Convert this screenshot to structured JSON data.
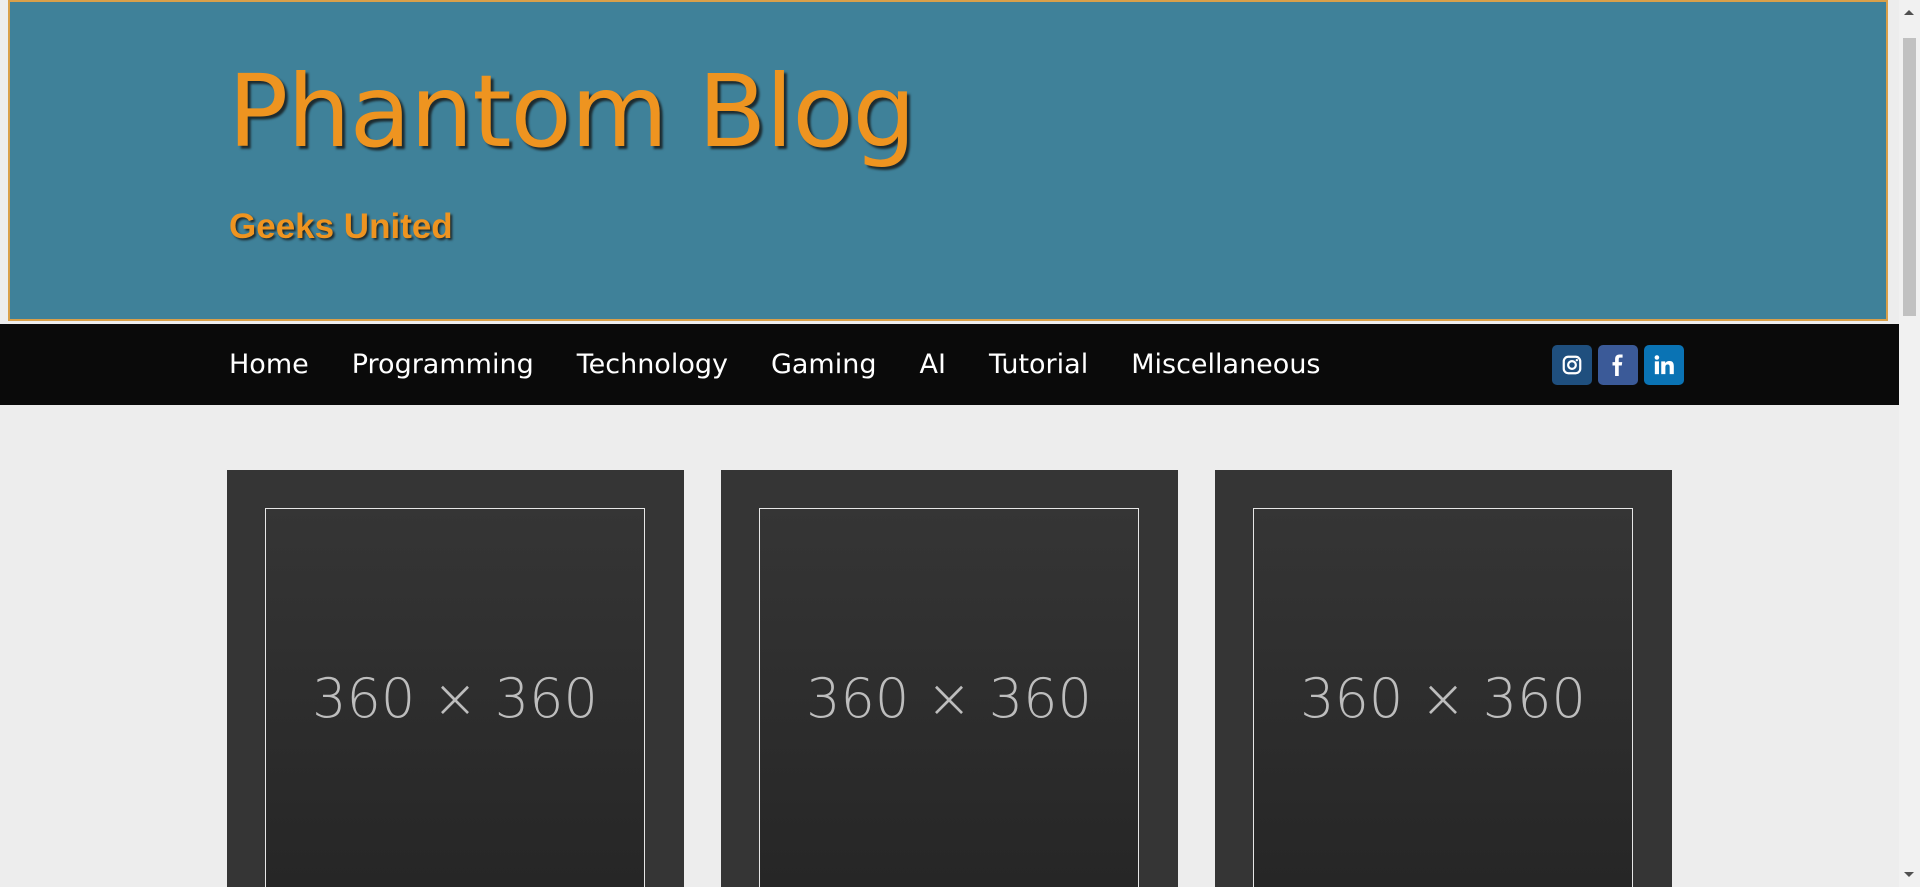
{
  "header": {
    "title": "Phantom Blog",
    "tagline": "Geeks United"
  },
  "nav": {
    "items": [
      {
        "label": "Home"
      },
      {
        "label": "Programming"
      },
      {
        "label": "Technology"
      },
      {
        "label": "Gaming"
      },
      {
        "label": "AI"
      },
      {
        "label": "Tutorial"
      },
      {
        "label": "Miscellaneous"
      }
    ]
  },
  "social": {
    "items": [
      {
        "icon": "instagram-icon",
        "color": "#1f4f7e"
      },
      {
        "icon": "facebook-icon",
        "color": "#3b5a98"
      },
      {
        "icon": "linkedin-icon",
        "color": "#0a73b4"
      }
    ]
  },
  "posts": [
    {
      "thumbnail_text": "360 × 360"
    },
    {
      "thumbnail_text": "360 × 360"
    },
    {
      "thumbnail_text": "360 × 360"
    }
  ],
  "colors": {
    "header_bg": "#3f8199",
    "accent": "#ee9420",
    "nav_bg": "#0a0a0a",
    "page_bg": "#ededed",
    "card_bg": "#353535"
  }
}
